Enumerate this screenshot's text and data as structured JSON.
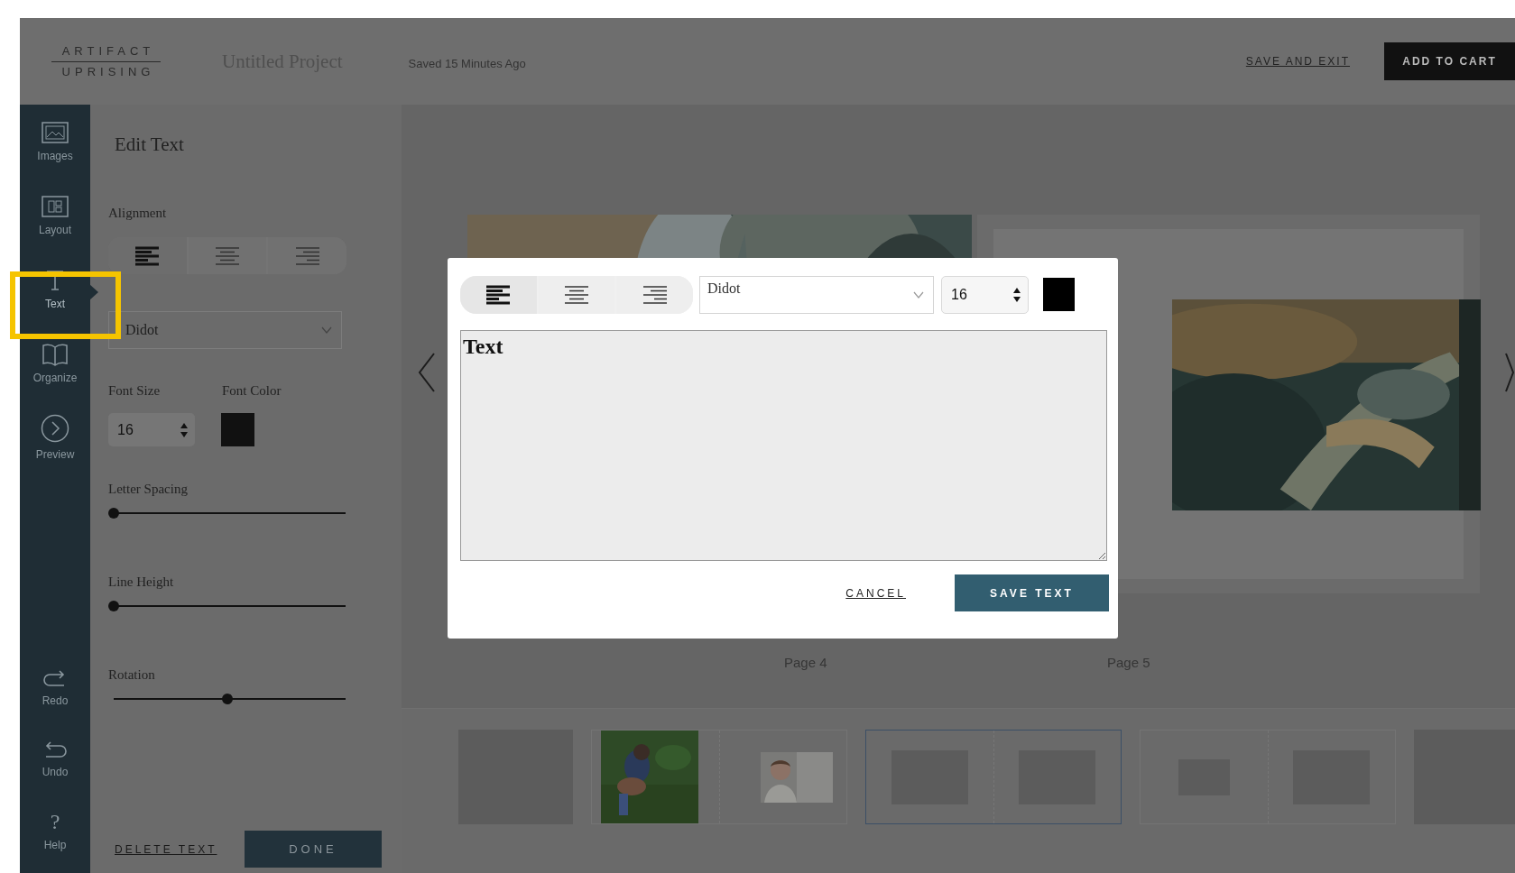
{
  "header": {
    "logo": [
      "ARTIFACT",
      "UPRISING"
    ],
    "project_title": "Untitled Project",
    "save_status": "Saved 15 Minutes Ago",
    "save_and_exit": "SAVE AND EXIT",
    "add_to_cart": "ADD TO CART"
  },
  "nav": {
    "tools": [
      {
        "label": "Images",
        "selected": false,
        "highlighted": false
      },
      {
        "label": "Layout",
        "selected": false,
        "highlighted": false
      },
      {
        "label": "Text",
        "selected": true,
        "highlighted": true
      },
      {
        "label": "Organize",
        "selected": false,
        "highlighted": false
      },
      {
        "label": "Preview",
        "selected": false,
        "highlighted": false
      }
    ],
    "actions": [
      {
        "label": "Redo"
      },
      {
        "label": "Undo"
      },
      {
        "label": "Help",
        "glyph": "?"
      }
    ]
  },
  "panel": {
    "title": "Edit Text",
    "alignment_label": "Alignment",
    "alignment": [
      {
        "kind": "left",
        "selected": true
      },
      {
        "kind": "center",
        "selected": false
      },
      {
        "kind": "right",
        "selected": false
      }
    ],
    "font": "Didot",
    "font_size_label": "Font Size",
    "font_color_label": "Font Color",
    "font_size": "16",
    "sliders": [
      {
        "label": "Letter Spacing",
        "level": 0
      },
      {
        "label": "Line Height",
        "level": 0
      },
      {
        "label": "Rotation",
        "level": 0.49
      }
    ],
    "delete": "DELETE TEXT",
    "done": "DONE"
  },
  "canvas": {
    "pages": [
      {
        "label": "Page 4"
      },
      {
        "label": "Page 5"
      }
    ]
  },
  "modal": {
    "alignment": [
      {
        "kind": "left",
        "selected": true
      },
      {
        "kind": "center",
        "selected": false
      },
      {
        "kind": "right",
        "selected": false
      }
    ],
    "font": "Didot",
    "font_size": "16",
    "text": "Text",
    "cancel": "CANCEL",
    "save": "SAVE TEXT"
  },
  "thumbnails": [
    {
      "kind": "single",
      "selected": false
    },
    {
      "kind": "spread",
      "selected": false
    },
    {
      "kind": "spread",
      "selected": true,
      "slots": [
        {
          "kind": "placeholder"
        },
        {
          "kind": "placeholder"
        }
      ]
    },
    {
      "kind": "spread",
      "selected": false,
      "slots": [
        {
          "kind": "placeholder-small"
        },
        {
          "kind": "placeholder"
        }
      ]
    },
    {
      "kind": "single",
      "selected": false
    }
  ]
}
